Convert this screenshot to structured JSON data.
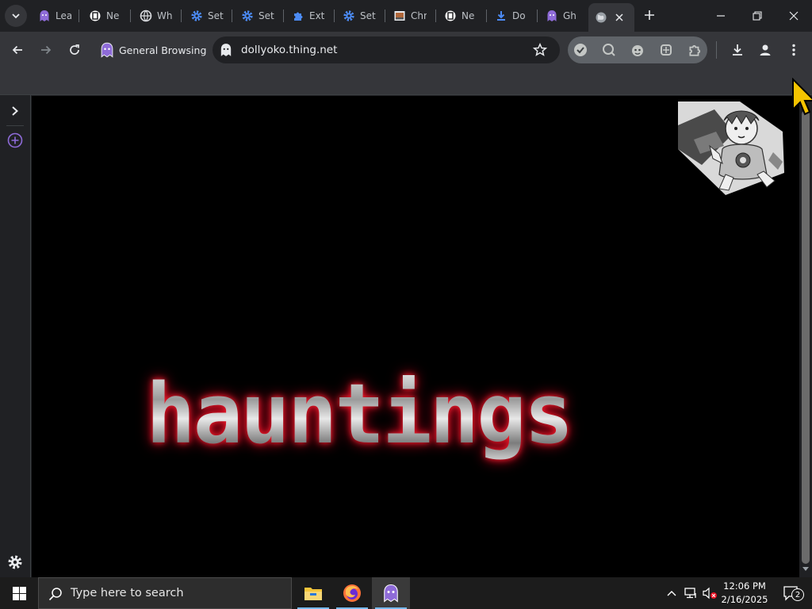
{
  "browser": {
    "tabs": [
      {
        "title": "Lea",
        "icon": "ghost-icon"
      },
      {
        "title": "Ne",
        "icon": "notion-icon"
      },
      {
        "title": "Wh",
        "icon": "globe-icon"
      },
      {
        "title": "Set",
        "icon": "gear-icon"
      },
      {
        "title": "Set",
        "icon": "gear-icon"
      },
      {
        "title": "Ext",
        "icon": "puzzle-icon"
      },
      {
        "title": "Set",
        "icon": "gear-icon"
      },
      {
        "title": "Chr",
        "icon": "image-icon"
      },
      {
        "title": "Ne",
        "icon": "notion-icon"
      },
      {
        "title": "Do",
        "icon": "download-icon"
      },
      {
        "title": "Gh",
        "icon": "ghost-icon"
      },
      {
        "title": "",
        "icon": "globe-icon",
        "active": true
      }
    ],
    "profile_label": "General Browsing",
    "url": "dollyoko.thing.net",
    "accent": "#8ab4f8"
  },
  "page": {
    "headline": "hauntings",
    "image": "doll-image"
  },
  "taskbar": {
    "search_placeholder": "Type here to search",
    "time": "12:06 PM",
    "date": "2/16/2025",
    "notification_count": "2"
  }
}
